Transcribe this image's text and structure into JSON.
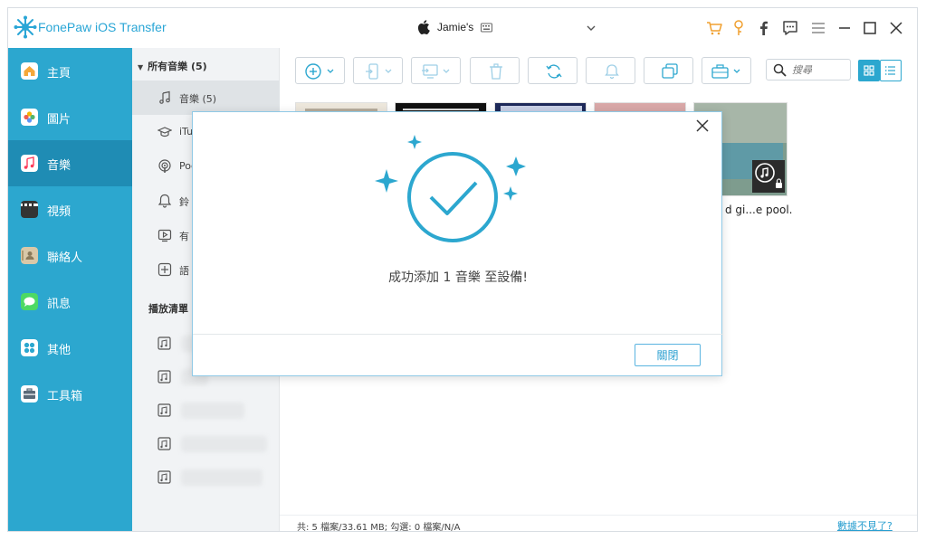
{
  "app": {
    "title": "FonePaw iOS Transfer",
    "device_name": "Jamie's"
  },
  "sidebar": {
    "items": [
      {
        "label": "主頁",
        "icon": "home-icon",
        "color": "#f4a83a"
      },
      {
        "label": "圖片",
        "icon": "photos-icon",
        "color": "#ffffff"
      },
      {
        "label": "音樂",
        "icon": "music-icon",
        "color": "#ffffff",
        "active": true
      },
      {
        "label": "視頻",
        "icon": "video-icon",
        "color": "#333333"
      },
      {
        "label": "聯絡人",
        "icon": "contacts-icon",
        "color": "#d9c8a8"
      },
      {
        "label": "訊息",
        "icon": "messages-icon",
        "color": "#4cd964"
      },
      {
        "label": "其他",
        "icon": "other-icon",
        "color": "#ffffff"
      },
      {
        "label": "工具箱",
        "icon": "toolbox-icon",
        "color": "#ffffff"
      }
    ]
  },
  "subpanel": {
    "header": "所有音樂 (5)",
    "items": [
      {
        "label": "音樂 (5)",
        "icon": "music-note-icon"
      },
      {
        "label": "iTu",
        "icon": "itunes-u-icon"
      },
      {
        "label": "Pod",
        "icon": "podcast-icon"
      },
      {
        "label": "鈴",
        "icon": "ringtone-icon"
      },
      {
        "label": "有",
        "icon": "audiobook-icon"
      },
      {
        "label": "語",
        "icon": "voice-memo-icon"
      }
    ],
    "playlist_header": "播放清單"
  },
  "toolbar": {
    "search_placeholder": "搜尋"
  },
  "albums": {
    "caption": "d gi...e pool.",
    "accent_colors": [
      "#e8e2d8",
      "#111111",
      "#1e2a5a",
      "#d9a8a8",
      "#6e8c82"
    ]
  },
  "status": {
    "text": "共: 5 檔案/33.61 MB; 勾選: 0 檔案/N/A",
    "link": "數據不見了?"
  },
  "dialog": {
    "message": "成功添加 1 音樂 至設備!",
    "close_button": "關閉",
    "accent": "#2ca7cf"
  }
}
